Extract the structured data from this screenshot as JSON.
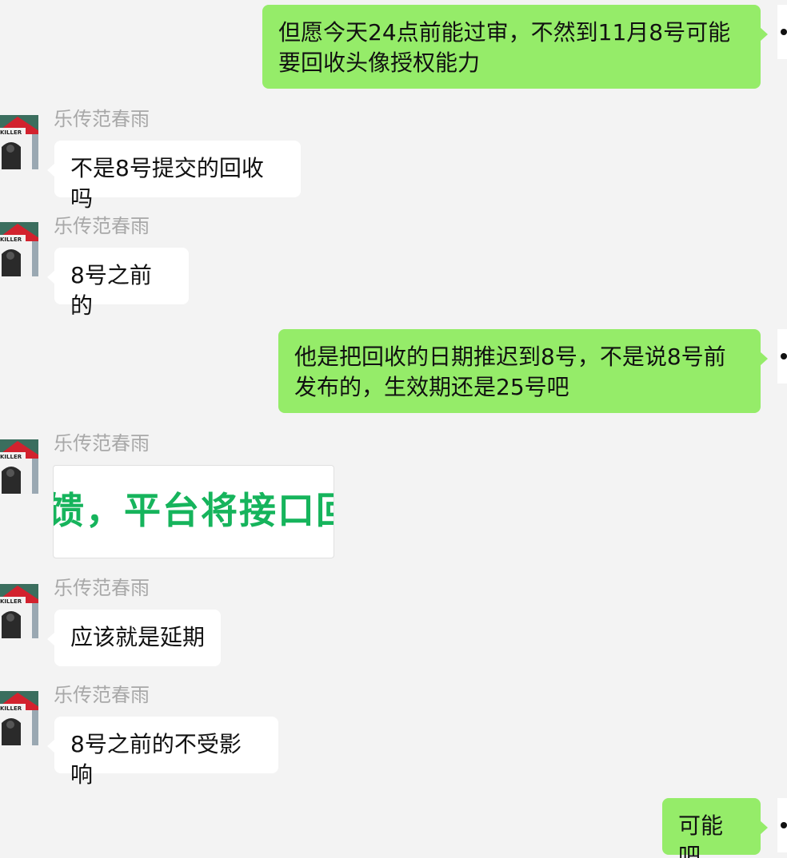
{
  "contact": {
    "name": "乐传范春雨",
    "avatar_label": "KILLER"
  },
  "messages": [
    {
      "side": "right",
      "type": "text",
      "text": "但愿今天24点前能过审，不然到11月8号可能要回收头像授权能力"
    },
    {
      "side": "left",
      "type": "text",
      "sender": "乐传范春雨",
      "text": "不是8号提交的回收吗"
    },
    {
      "side": "left",
      "type": "text",
      "sender": "乐传范春雨",
      "text": "8号之前的"
    },
    {
      "side": "right",
      "type": "text",
      "text": "他是把回收的日期推迟到8号，不是说8号前发布的，生效期还是25号吧"
    },
    {
      "side": "left",
      "type": "image",
      "sender": "乐传范春雨",
      "text": "馈，平台将接口回"
    },
    {
      "side": "left",
      "type": "text",
      "sender": "乐传范春雨",
      "text": "应该就是延期"
    },
    {
      "side": "left",
      "type": "text",
      "sender": "乐传范春雨",
      "text": "8号之前的不受影响"
    },
    {
      "side": "right",
      "type": "text",
      "text": "可能吧"
    }
  ],
  "colors": {
    "background": "#f3f3f3",
    "self_bubble": "#95ec69",
    "other_bubble": "#ffffff",
    "sender_name": "#a8a8a8",
    "image_text": "#16b45c"
  },
  "icons": {
    "avatar": "doghouse-killer-avatar"
  }
}
